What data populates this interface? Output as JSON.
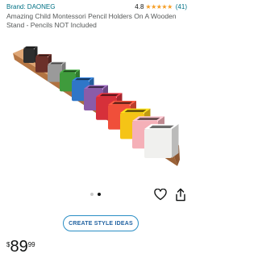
{
  "brand": {
    "link_text": "Brand: DAONEG"
  },
  "rating": {
    "value": "4.8",
    "stars": "★★★★★",
    "count": "(41)"
  },
  "product": {
    "title": "Amazing Child Montessori Pencil Holders On A Wooden Stand - Pencils NOT Included",
    "image_alt": "Wooden stand holding a rainbow row of square pencil cups"
  },
  "carousel": {
    "total": 2,
    "active": 2
  },
  "actions": {
    "wishlist_icon": "heart-icon",
    "share_icon": "share-icon"
  },
  "style_button": {
    "label": "CREATE STYLE IDEAS"
  },
  "price": {
    "symbol": "$",
    "whole": "89",
    "fraction": "99"
  },
  "colors": {
    "link": "#007185",
    "star": "#f59d24",
    "button_border": "#2a8ec5",
    "button_text": "#2162a1",
    "cups": [
      "#2e2e2e",
      "#6b3029",
      "#9a9a9a",
      "#3f9b3c",
      "#2f76c8",
      "#8a5ca8",
      "#d6303a",
      "#f04f3a",
      "#f5c416",
      "#f5b0b8",
      "#f0f0ee"
    ]
  }
}
